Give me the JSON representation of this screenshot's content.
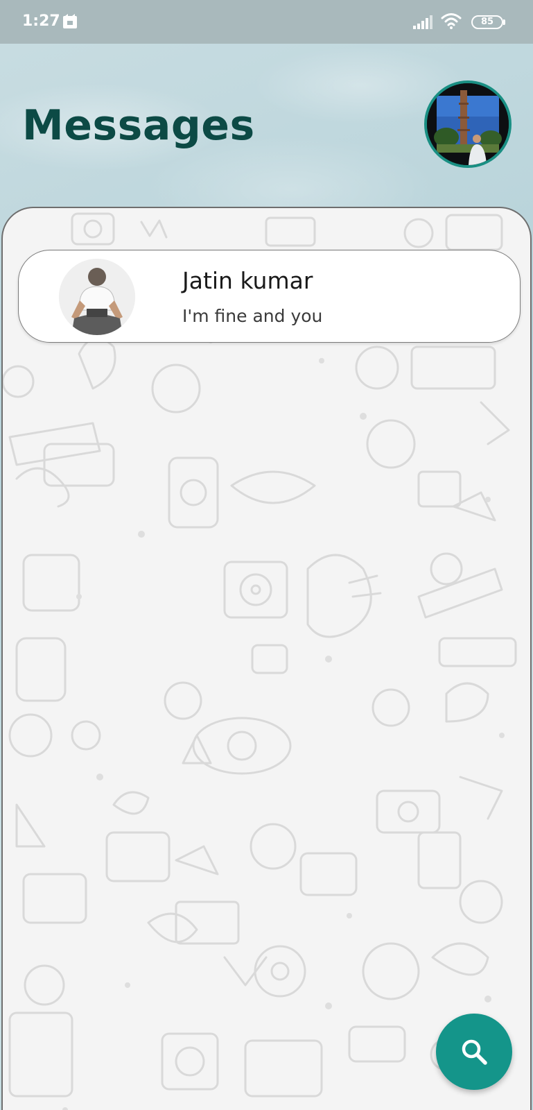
{
  "status_bar": {
    "time": "1:27",
    "battery_level": "85",
    "notification_icon": "notification-app-icon",
    "signal_icon": "cellular-signal-icon",
    "wifi_icon": "wifi-icon"
  },
  "header": {
    "title": "Messages",
    "profile_avatar": "profile-avatar-photo"
  },
  "chats": [
    {
      "name": "Jatin kumar",
      "last_message": "I'm fine and you",
      "avatar": "contact-avatar-photo"
    }
  ],
  "fab": {
    "icon": "search-icon"
  },
  "colors": {
    "title": "#0c4a45",
    "accent": "#14958a",
    "avatar_ring": "#1a8f83",
    "panel_background": "#f4f4f4",
    "status_bar": "#a9b9bc"
  }
}
